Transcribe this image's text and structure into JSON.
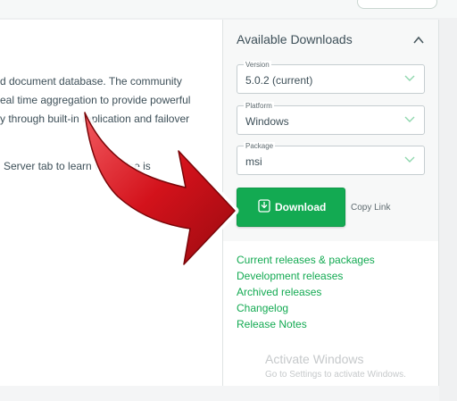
{
  "description": {
    "lines": [
      "d document database. The community",
      "eal time aggregation to provide powerful",
      "y through built-in replication and failover",
      "Server tab to learn what else is"
    ]
  },
  "downloads": {
    "title": "Available Downloads",
    "version": {
      "label": "Version",
      "value": "5.0.2 (current)"
    },
    "platform": {
      "label": "Platform",
      "value": "Windows"
    },
    "package": {
      "label": "Package",
      "value": "msi"
    },
    "download_label": "Download",
    "copy_link": "Copy Link",
    "accent_color": "#13aa52"
  },
  "links": [
    "Current releases & packages",
    "Development releases",
    "Archived releases",
    "Changelog",
    "Release Notes"
  ],
  "watermark": {
    "title": "Activate Windows",
    "subtitle": "Go to Settings to activate Windows."
  },
  "annotation": {
    "arrow_color": "#c8101a",
    "icon": "big-red-curved-arrow"
  }
}
